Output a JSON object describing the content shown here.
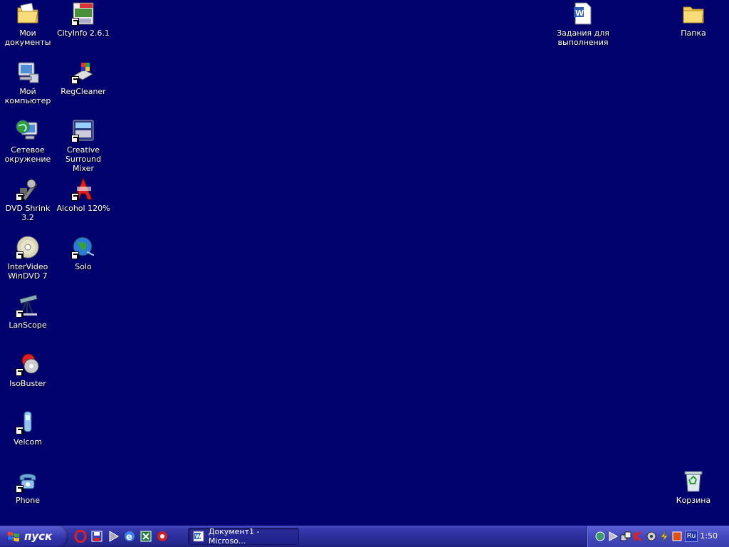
{
  "desktop_icons": {
    "my_documents": "Мои\nдокументы",
    "cityinfo": "CityInfo 2.6.1",
    "my_computer": "Мой\nкомпьютер",
    "regcleaner": "RegCleaner",
    "network": "Сетевое\nокружение",
    "creative_mixer": "Creative\nSurround Mixer",
    "dvd_shrink": "DVD Shrink 3.2",
    "alcohol": "Alcohol 120%",
    "windvd": "InterVideo\nWinDVD 7",
    "solo": "Solo",
    "lanscope": "LanScope",
    "isobuster": "IsoBuster",
    "velcom": "Velcom",
    "phone": "Phone",
    "tasks_doc": "Задания для\nвыполнения",
    "folder": "Папка",
    "recycle_bin": "Корзина"
  },
  "taskbar": {
    "start_label": "пуск",
    "quick_launch": [
      "opera-icon",
      "save-icon",
      "media-player-icon",
      "ie-icon",
      "excel-icon",
      "power-icon"
    ],
    "tasks": [
      {
        "label": "Документ1 - Microso..."
      }
    ],
    "tray_icons": [
      "network-icon",
      "media-icon",
      "connection-icon",
      "kaspersky-icon",
      "speaker-icon",
      "flash-icon",
      "square-icon"
    ],
    "language": "Ru",
    "clock": "1:50"
  },
  "colors": {
    "desktop_bg": "#02026e",
    "taskbar": "#2c2e9c",
    "tray": "#4348bd"
  }
}
